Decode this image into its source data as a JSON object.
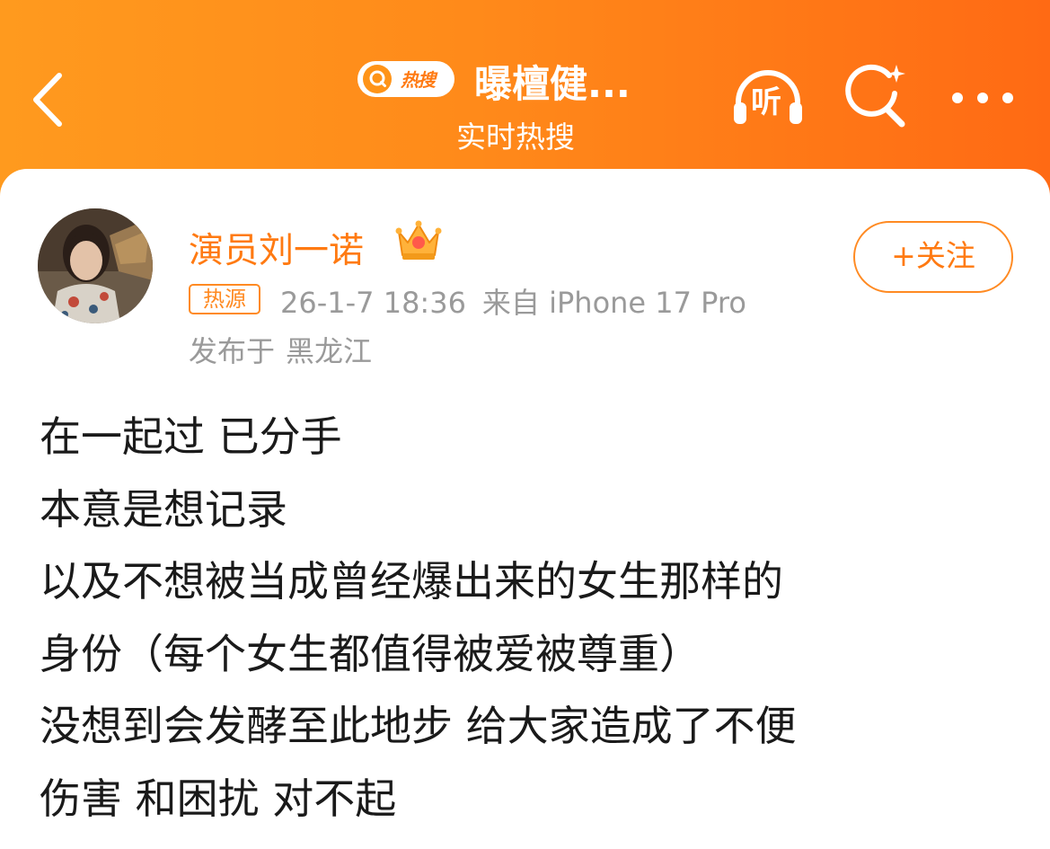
{
  "colors": {
    "header_gradient_start": "#ff9a1e",
    "header_gradient_end": "#ff6a14",
    "accent_orange": "#ff7a12",
    "meta_gray": "#9a9a9a",
    "body_text": "#1a1a1a"
  },
  "header": {
    "back_icon": "chevron-left-icon",
    "hot_badge_label": "热搜",
    "title": "曝檀健...",
    "subtitle": "实时热搜",
    "listen_label": "听",
    "listen_icon": "headphones-icon",
    "search_icon": "search-sparkle-icon",
    "more_icon": "more-dots-icon"
  },
  "post": {
    "author": {
      "name": "演员刘一诺",
      "verified_icon": "crown-icon",
      "avatar": "avatar-photo"
    },
    "source_badge": "热源",
    "timestamp": "26-1-7 18:36",
    "device": "来自 iPhone 17 Pro",
    "location_prefix": "发布于",
    "location": "黑龙江",
    "follow_label": "+关注",
    "lines": [
      "在一起过 已分手",
      "本意是想记录",
      "以及不想被当成曾经爆出来的女生那样的",
      "身份（每个女生都值得被爱被尊重）",
      "没想到会发酵至此地步 给大家造成了不便",
      "伤害 和困扰 对不起"
    ]
  }
}
